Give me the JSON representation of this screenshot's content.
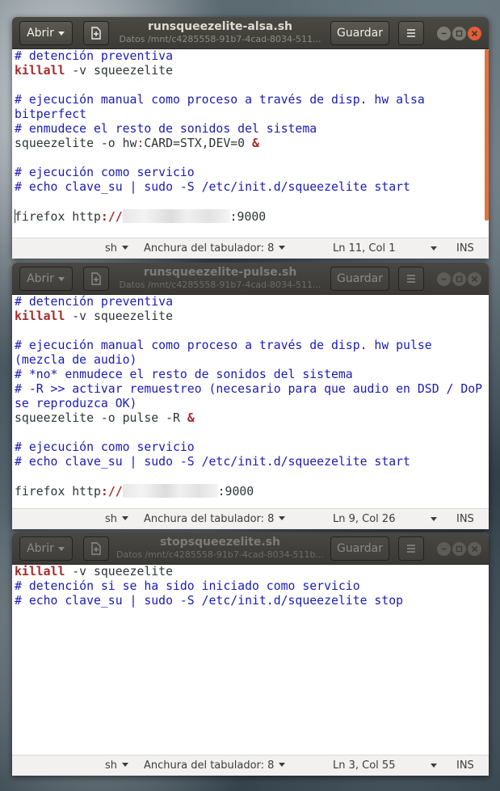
{
  "common": {
    "open_label": "Abrir",
    "save_label": "Guardar",
    "language": "sh",
    "tab_width": "Anchura del tabulador: 8",
    "insert_mode": "INS"
  },
  "colors": {
    "comment": "#1a1ab8",
    "keyword": "#a52a2a",
    "close_button": "#e65c36",
    "scrollbar": "#e2743a"
  },
  "windows": [
    {
      "title": "runsqueezelite-alsa.sh",
      "path": "Datos /mnt/c4285558-91b7-4cad-8034-511...",
      "cursor_pos": "Ln 11, Col 1",
      "lines": {
        "l1": "# detención preventiva",
        "l2_kw": "killall",
        "l2_rest": " -v squeezelite",
        "l4": "# ejecución manual como proceso a través de disp. hw alsa bitperfect",
        "l5": "# enmudece el resto de sonidos del sistema",
        "l6_a": "squeezelite -o hw",
        "l6_colon": ":",
        "l6_b": "CARD=STX,DEV=0 ",
        "l6_amp": "&",
        "l8": "# ejecución como servicio",
        "l9": "# echo clave_su | sudo -S /etc/init.d/squeezelite start",
        "l11_a": "firefox http",
        "l11_slash": "://",
        "l11_port": ":9000"
      }
    },
    {
      "title": "runsqueezelite-pulse.sh",
      "path": "Datos /mnt/c4285558-91b7-4cad-8034-511...",
      "cursor_pos": "Ln 9, Col 26",
      "lines": {
        "l1": "# detención preventiva",
        "l2_kw": "killall",
        "l2_rest": " -v squeezelite",
        "l4": "# ejecución manual como proceso a través de disp. hw pulse (mezcla de audio)",
        "l5": "# *no* enmudece el resto de sonidos del sistema",
        "l6": "# -R >> activar remuestreo (necesario para que audio en DSD / DoP se reproduzca OK)",
        "l7_a": "squeezelite -o pulse -R ",
        "l7_amp": "&",
        "l9": "# ejecución como servicio",
        "l10": "# echo clave_su | sudo -S /etc/init.d/squeezelite start",
        "l12_a": "firefox http",
        "l12_slash": "://",
        "l12_port": ":9000"
      }
    },
    {
      "title": "stopsqueezelite.sh",
      "path": "Datos /mnt/c4285558-91b7-4cad-8034-511b...",
      "cursor_pos": "Ln 3, Col 55",
      "lines": {
        "l1_kw": "killall",
        "l1_rest": " -v squeezelite",
        "l2": "# detención si se ha sido iniciado como servicio",
        "l3": "# echo clave_su | sudo -S /etc/init.d/squeezelite stop"
      }
    }
  ]
}
